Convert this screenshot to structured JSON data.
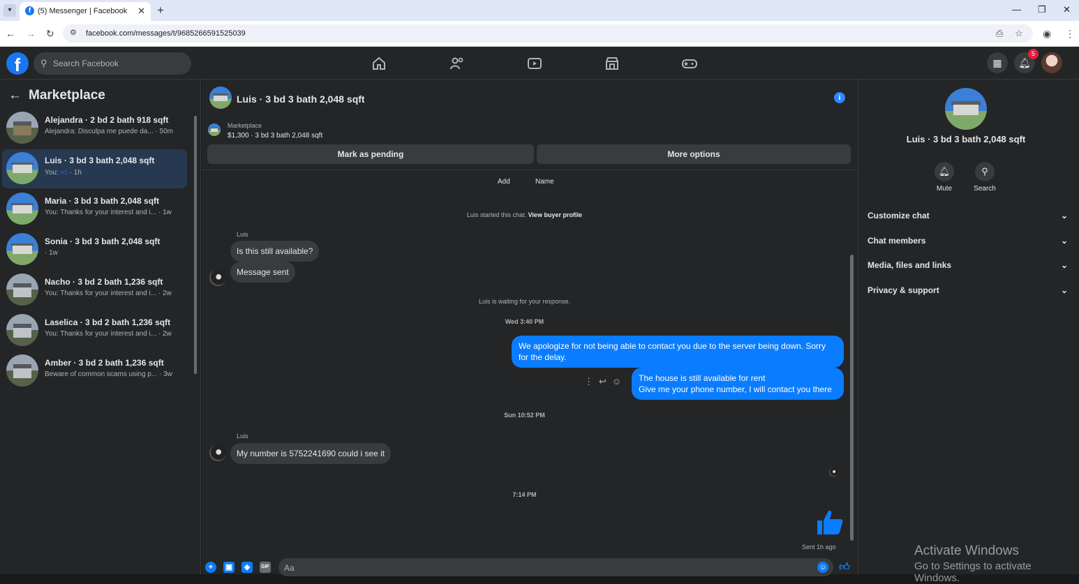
{
  "browser": {
    "tab_title": "(5) Messenger | Facebook",
    "url": "facebook.com/messages/t/9685266591525039"
  },
  "fb": {
    "search_placeholder": "Search Facebook",
    "notification_count": "5"
  },
  "sidebar": {
    "title": "Marketplace",
    "conversations": [
      {
        "name": "Alejandra · 2 bd 2 bath 918 sqft",
        "preview": "Alejandra: Disculpa me puede da... · 50m"
      },
      {
        "name": "Luis · 3 bd 3 bath 2,048 sqft",
        "preview_prefix": "You:",
        "preview_suffix": "· 1h"
      },
      {
        "name": "Maria · 3 bd 3 bath 2,048 sqft",
        "preview": "You: Thanks for your interest and i...  · 1w"
      },
      {
        "name": "Sonia · 3 bd 3 bath 2,048 sqft",
        "preview": "· 1w"
      },
      {
        "name": "Nacho · 3 bd 2 bath 1,236 sqft",
        "preview": "You: Thanks for your interest and i...  · 2w"
      },
      {
        "name": "Laselica · 3 bd 2 bath 1,236 sqft",
        "preview": "You: Thanks for your interest and i...  · 2w"
      },
      {
        "name": "Amber · 3 bd 2 bath 1,236 sqft",
        "preview": "Beware of common scams using p... · 3w"
      }
    ]
  },
  "chat": {
    "title": "Luis · 3 bd 3 bath 2,048 sqft",
    "marketplace_label": "Marketplace",
    "listing": "$1,300 · 3 bd 3 bath 2,048 sqft",
    "mark_pending": "Mark as pending",
    "more_options": "More options",
    "add_label": "Add",
    "name_label": "Name",
    "started_text": "Luis started this chat.",
    "view_profile": "View buyer profile",
    "sender1": "Luis",
    "msg1": "Is this still available?",
    "msg2": "Message sent",
    "waiting": "Luis is waiting for your response.",
    "ts1": "Wed 3:40 PM",
    "out1_line1": "We apologize for not being able to contact you due to the server being down. Sorry",
    "out1_line2": "for the delay.",
    "out2_line1": "The house is still available for rent",
    "out2_line2": " Give me your phone number, I will contact you there",
    "ts2": "Sun 10:52 PM",
    "sender2": "Luis",
    "msg3": "My number is 5752241690  could i see it",
    "ts3": "7:14 PM",
    "sent_note": "Sent 1h ago",
    "composer_placeholder": "Aa"
  },
  "right_panel": {
    "title": "Luis · 3 bd 3 bath 2,048 sqft",
    "mute": "Mute",
    "search": "Search",
    "sections": [
      "Customize chat",
      "Chat members",
      "Media, files and links",
      "Privacy & support"
    ]
  },
  "watermark": {
    "line1": "Activate Windows",
    "line2": "Go to Settings to activate Windows."
  },
  "colors": {
    "accent": "#0a7cff",
    "background": "#242526",
    "bubble_in": "#3a3b3c"
  }
}
